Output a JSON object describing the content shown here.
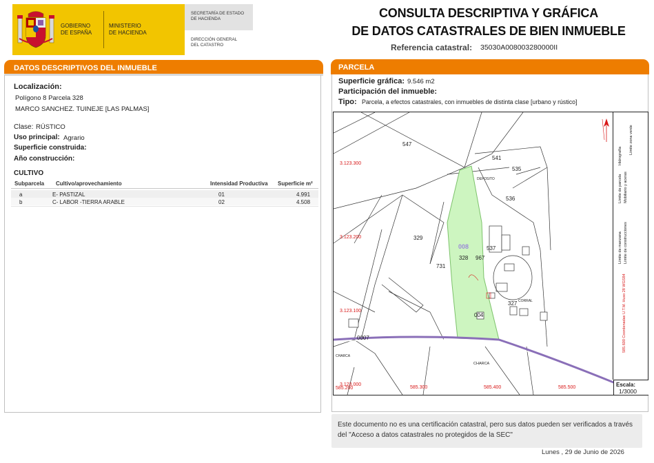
{
  "header": {
    "gov_line1": "GOBIERNO",
    "gov_line2": "DE ESPAÑA",
    "min_line1": "MINISTERIO",
    "min_line2": "DE HACIENDA",
    "sec_line1": "SECRETARÍA DE ESTADO",
    "sec_line2": "DE HACIENDA",
    "dir_line1": "DIRECCIÓN GENERAL",
    "dir_line2": "DEL CATASTRO",
    "title_line1": "CONSULTA DESCRIPTIVA Y GRÁFICA",
    "title_line2": "DE DATOS CATASTRALES DE BIEN INMUEBLE",
    "ref_label": "Referencia catastral:",
    "ref_value": "35030A008003280000II"
  },
  "left": {
    "section_title": "DATOS DESCRIPTIVOS DEL INMUEBLE",
    "localizacion_label": "Localización:",
    "localizacion_line1": "Polígono 8 Parcela 328",
    "localizacion_line2": "MARCO SANCHEZ. TUINEJE [LAS PALMAS]",
    "clase_label": "Clase:",
    "clase_value": "RÚSTICO",
    "uso_label": "Uso principal:",
    "uso_value": "Agrario",
    "sup_construida_label": "Superficie construida:",
    "anio_label": "Año construcción:",
    "cultivo_title": "CULTIVO",
    "cultivo_headers": [
      "Subparcela",
      "Cultivo/aprovechamiento",
      "Intensidad Productiva",
      "Superficie m²"
    ],
    "cultivo_rows": [
      [
        "a",
        "E- PASTIZAL",
        "01",
        "4.991"
      ],
      [
        "b",
        "C- LABOR -TIERRA ARABLE",
        "02",
        "4.508"
      ]
    ]
  },
  "right": {
    "section_title": "PARCELA",
    "sup_grafica_label": "Superficie gráfica:",
    "sup_grafica_value": "9.546 m2",
    "participacion_label": "Participación del inmueble:",
    "tipo_label": "Tipo:",
    "tipo_value": "Parcela, a efectos catastrales, con inmuebles de distinta clase [urbano y rústico]"
  },
  "map": {
    "parcel_numbers": [
      "547",
      "541",
      "535",
      "536",
      "329",
      "328",
      "967",
      "537",
      "731",
      "327",
      "0007",
      "008",
      "004"
    ],
    "place_labels": [
      "DEPOSITO",
      "CORRAL",
      "CHARCA",
      "CHARCA"
    ],
    "y_coords": [
      "3.123.300",
      "3.123.200",
      "3.123.100",
      "3.123.000"
    ],
    "x_coords": [
      "585.200",
      "585.300",
      "585.400",
      "585.500"
    ],
    "legend_items": [
      "Límite de manzana",
      "Límite de parcela",
      "Límite de construcciones",
      "Mobiliario y aceras",
      "Límite zona verde",
      "Hidrografía"
    ],
    "crs_note": "585.600 Coordenadas U.T.M. Huso 28 WGS84",
    "escala_label": "Escala:",
    "escala_value": "1/3000",
    "colors": {
      "parcel_fill": "#cdf5c0",
      "parcel_stroke": "#7cc26a",
      "road": "#8a6fb8",
      "coord_red": "#d81818"
    }
  },
  "footer": {
    "note": "Este documento no es una certificación catastral, pero sus datos pueden ser verificados a través del \"Acceso a datos catastrales no protegidos de la SEC\"",
    "date": "Lunes , 29 de Junio de 2026"
  }
}
